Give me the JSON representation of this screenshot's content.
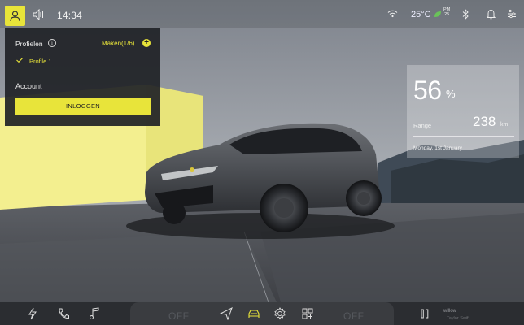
{
  "status_bar": {
    "time": "14:34",
    "temperature": "25°C",
    "air_quality_label": "PM",
    "air_quality_value": "25",
    "icons": [
      "profile-icon",
      "volume-icon",
      "wifi-icon",
      "leaf-icon",
      "bluetooth-icon",
      "bell-icon",
      "settings-icon"
    ]
  },
  "profile_panel": {
    "title": "Profielen",
    "info_symbol": "i",
    "create_label": "Maken(1/6)",
    "add_symbol": "+",
    "active_profile": "Profile 1",
    "account_label": "Account",
    "login_button": "INLOGGEN"
  },
  "range_panel": {
    "battery_percent": "56",
    "battery_unit": "%",
    "range_label": "Range",
    "range_value": "238",
    "range_unit": "km",
    "date": "Monday, 1st January"
  },
  "dock": {
    "left_climate": "OFF",
    "right_climate": "OFF",
    "music_title": "willow",
    "music_artist": "Taylor Swift",
    "icons": [
      "charging-icon",
      "phone-icon",
      "music-icon",
      "navigation-icon",
      "car-icon",
      "settings-gear-icon",
      "apps-icon",
      "pause-icon"
    ]
  },
  "colors": {
    "accent": "#e8e43a",
    "panel_dark": "#202226",
    "dock": "#2b2d31"
  }
}
